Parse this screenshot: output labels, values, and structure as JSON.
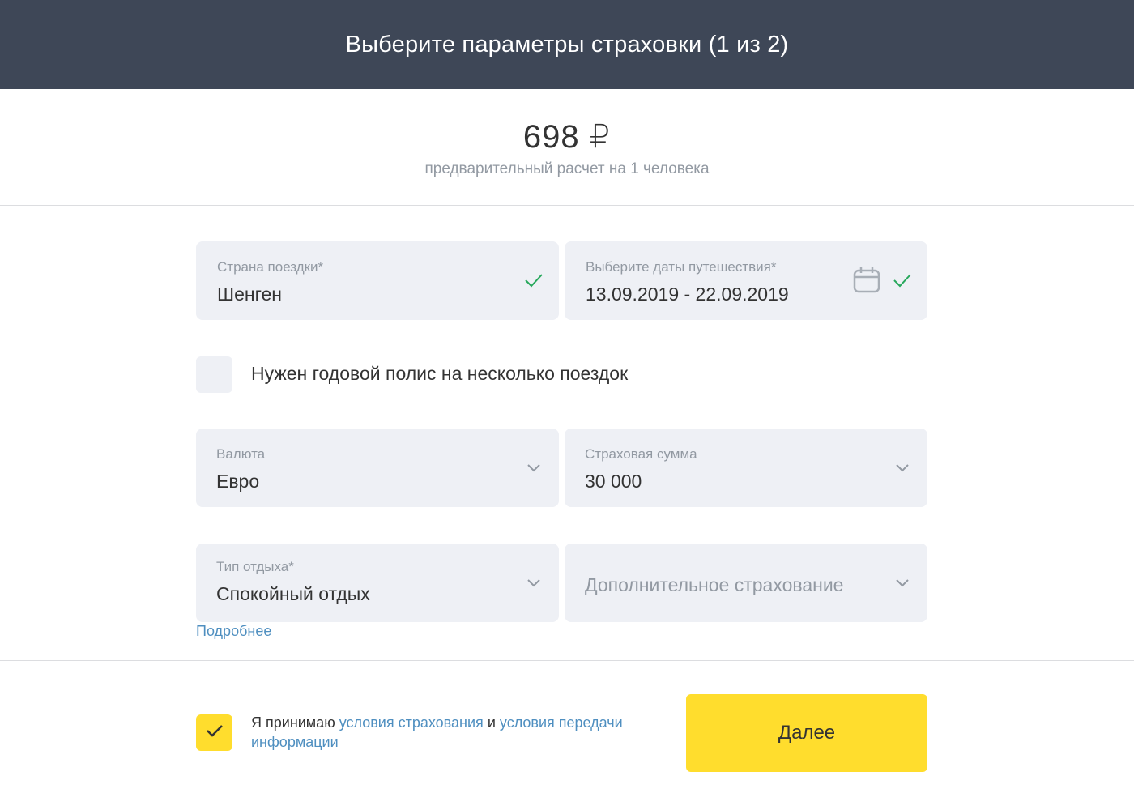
{
  "header": {
    "title": "Выберите параметры страховки (1 из 2)"
  },
  "price": {
    "amount": "698 ₽",
    "subtitle": "предварительный расчет на 1 человека"
  },
  "form": {
    "country": {
      "label": "Страна поездки*",
      "value": "Шенген",
      "icon": "checkmark-icon"
    },
    "dates": {
      "label": "Выберите даты путешествия*",
      "value": "13.09.2019 - 22.09.2019",
      "icons": [
        "calendar-icon",
        "checkmark-icon"
      ]
    },
    "annual_policy": {
      "label": "Нужен годовой полис на несколько поездок",
      "checked": false
    },
    "currency": {
      "label": "Валюта",
      "value": "Евро",
      "icon": "chevron-down-icon"
    },
    "insured_sum": {
      "label": "Страховая сумма",
      "value": "30 000",
      "icon": "chevron-down-icon"
    },
    "vacation_type": {
      "label": "Тип отдыха*",
      "value": "Спокойный отдых",
      "icon": "chevron-down-icon"
    },
    "additional": {
      "placeholder": "Дополнительное страхование",
      "icon": "chevron-down-icon"
    },
    "more_link": "Подробнее"
  },
  "footer": {
    "agree_checked": true,
    "agree_prefix": "Я принимаю",
    "agree_link_1": "условия страхования",
    "agree_and": "и",
    "agree_link_2": "условия передачи информации",
    "next_label": "Далее"
  },
  "colors": {
    "header_bg": "#3e4757",
    "field_bg": "#eef0f5",
    "accent_yellow": "#ffdd2d",
    "link_blue": "#4f8fc0",
    "check_green": "#27a85c"
  }
}
